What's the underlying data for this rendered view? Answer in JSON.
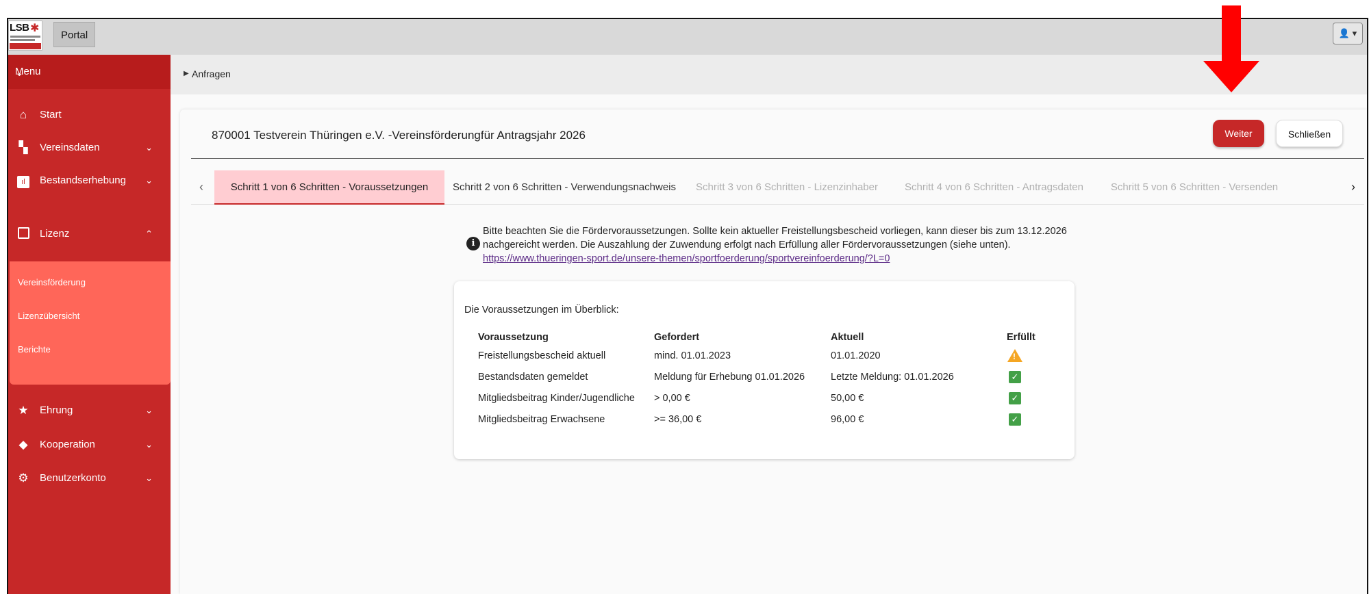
{
  "topbar": {
    "logo_text": "LSB",
    "portal_label": "Portal",
    "user_menu_label": "👤 ▾"
  },
  "sidebar": {
    "menu_label": "Menu",
    "items": [
      {
        "label": "Start"
      },
      {
        "label": "Vereinsdaten"
      },
      {
        "label": "Bestandserhebung"
      },
      {
        "label": "Lizenz"
      },
      {
        "label": "Ehrung"
      },
      {
        "label": "Kooperation"
      },
      {
        "label": "Benutzerkonto"
      }
    ],
    "sub_items": [
      {
        "label": "Vereinsförderung"
      },
      {
        "label": "Lizenzübersicht"
      },
      {
        "label": "Berichte"
      }
    ]
  },
  "breadcrumb": {
    "label": "Anfragen"
  },
  "card": {
    "title": "870001 Testverein Thüringen e.V. -Vereinsförderungfür Antragsjahr 2026",
    "next_label": "Weiter",
    "close_label": "Schließen"
  },
  "tabs": [
    {
      "label": "Schritt 1 von 6 Schritten - Voraussetzungen",
      "state": "active"
    },
    {
      "label": "Schritt 2 von 6 Schritten - Verwendungsnachweis",
      "state": "normal"
    },
    {
      "label": "Schritt 3 von 6 Schritten - Lizenzinhaber",
      "state": "disabled"
    },
    {
      "label": "Schritt 4 von 6 Schritten - Antragsdaten",
      "state": "disabled"
    },
    {
      "label": "Schritt 5 von 6 Schritten - Versenden",
      "state": "disabled"
    }
  ],
  "info": {
    "text": "Bitte beachten Sie die Fördervoraussetzungen. Sollte kein aktueller Freistellungsbescheid vorliegen, kann dieser bis zum 13.12.2026 nachgereicht werden. Die Auszahlung der Zuwendung erfolgt nach Erfüllung aller Fördervoraussetzungen (siehe unten).",
    "link": "https://www.thueringen-sport.de/unsere-themen/sportfoerderung/sportvereinfoerderung/?L=0"
  },
  "requirements": {
    "intro": "Die Voraussetzungen im Überblick:",
    "headers": {
      "req": "Voraussetzung",
      "required": "Gefordert",
      "current": "Aktuell",
      "fulfilled": "Erfüllt"
    },
    "rows": [
      {
        "req": "Freistellungsbescheid aktuell",
        "required": "mind. 01.01.2023",
        "current": "01.01.2020",
        "status": "warning"
      },
      {
        "req": "Bestandsdaten gemeldet",
        "required": "Meldung für Erhebung 01.01.2026",
        "current": "Letzte Meldung: 01.01.2026",
        "status": "ok"
      },
      {
        "req": "Mitgliedsbeitrag Kinder/Jugendliche",
        "required": "> 0,00 €",
        "current": "50,00 €",
        "status": "ok"
      },
      {
        "req": "Mitgliedsbeitrag Erwachsene",
        "required": ">= 36,00 €",
        "current": "96,00 €",
        "status": "ok"
      }
    ]
  },
  "colors": {
    "primary_red": "#c62828",
    "submenu_red": "#ff6659",
    "active_tab_bg": "#ffcdd2",
    "ok_green": "#43a047",
    "warning_orange": "#f5a623",
    "annotation_arrow": "#ff0000"
  }
}
